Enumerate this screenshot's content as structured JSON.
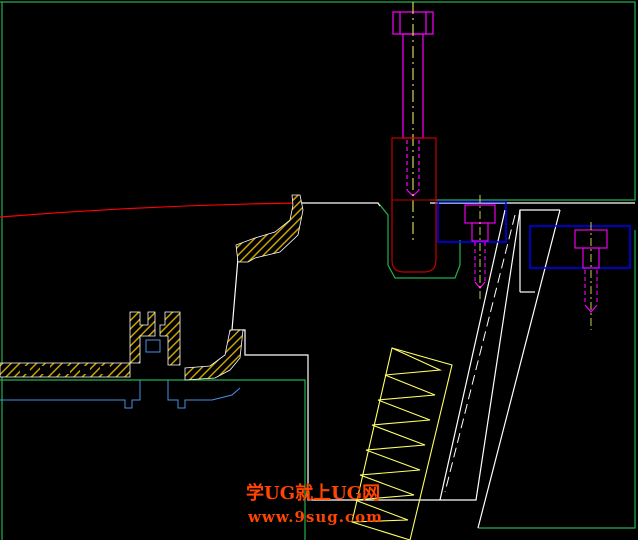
{
  "canvas": {
    "background": "#000000"
  },
  "colors": {
    "green": "#22b14c",
    "white": "#ffffff",
    "magenta": "#ff00ff",
    "red": "#ff0000",
    "darkred": "#c00000",
    "blue": "#0000ff",
    "lightblue": "#4a90e2",
    "yellow": "#ffff66",
    "hatch": "#c8a000"
  },
  "watermark": {
    "line1": "学UG就上UG网",
    "line2": "www.9sug.com",
    "color": "#ff4500"
  }
}
